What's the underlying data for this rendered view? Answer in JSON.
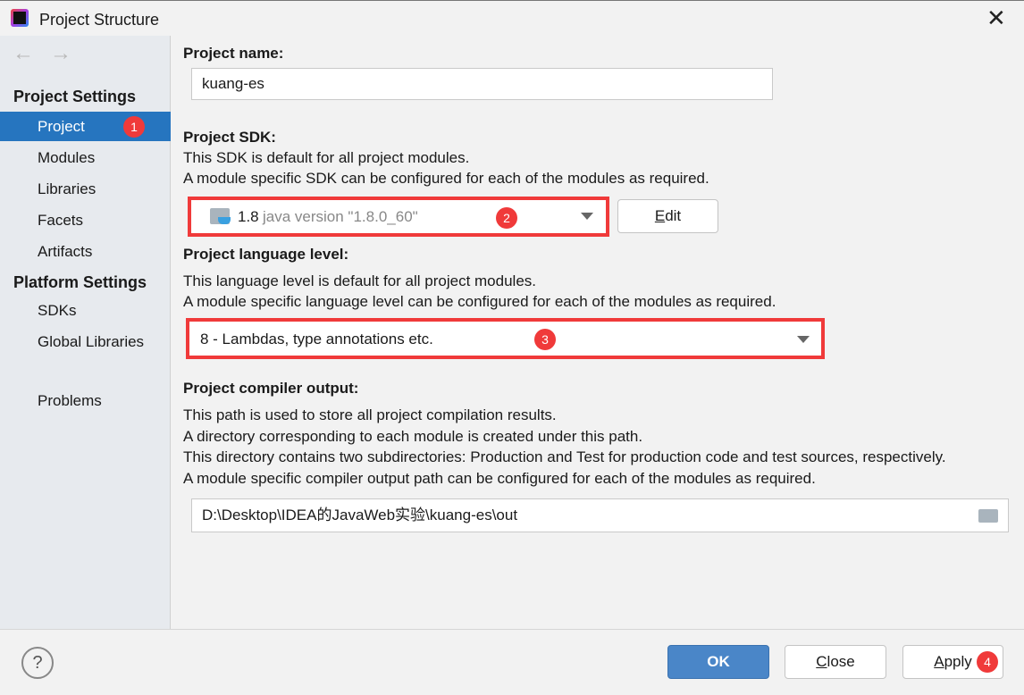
{
  "window": {
    "title": "Project Structure"
  },
  "sidebar": {
    "section1": "Project Settings",
    "items1": [
      "Project",
      "Modules",
      "Libraries",
      "Facets",
      "Artifacts"
    ],
    "section2": "Platform Settings",
    "items2": [
      "SDKs",
      "Global Libraries"
    ],
    "problems": "Problems",
    "selected": "Project"
  },
  "main": {
    "name_label": "Project name:",
    "name_value": "kuang-es",
    "sdk_label": "Project SDK:",
    "sdk_desc1": "This SDK is default for all project modules.",
    "sdk_desc2": "A module specific SDK can be configured for each of the modules as required.",
    "sdk_version": "1.8",
    "sdk_detail": "java version \"1.8.0_60\"",
    "edit_first": "E",
    "edit_rest": "dit",
    "lang_label": "Project language level:",
    "lang_desc1": "This language level is default for all project modules.",
    "lang_desc2": "A module specific language level can be configured for each of the modules as required.",
    "lang_value": "8 - Lambdas, type annotations etc.",
    "out_label": "Project compiler output:",
    "out_desc1": "This path is used to store all project compilation results.",
    "out_desc2": "A directory corresponding to each module is created under this path.",
    "out_desc3": "This directory contains two subdirectories: Production and Test for production code and test sources, respectively.",
    "out_desc4": "A module specific compiler output path can be configured for each of the modules as required.",
    "out_value": "D:\\Desktop\\IDEA的JavaWeb实验\\kuang-es\\out"
  },
  "footer": {
    "help": "?",
    "ok": "OK",
    "close_first": "C",
    "close_rest": "lose",
    "apply_first": "A",
    "apply_rest": "pply"
  },
  "badges": [
    "1",
    "2",
    "3",
    "4"
  ],
  "colors": {
    "accent": "#2675bf",
    "highlight": "#f03a3a"
  }
}
